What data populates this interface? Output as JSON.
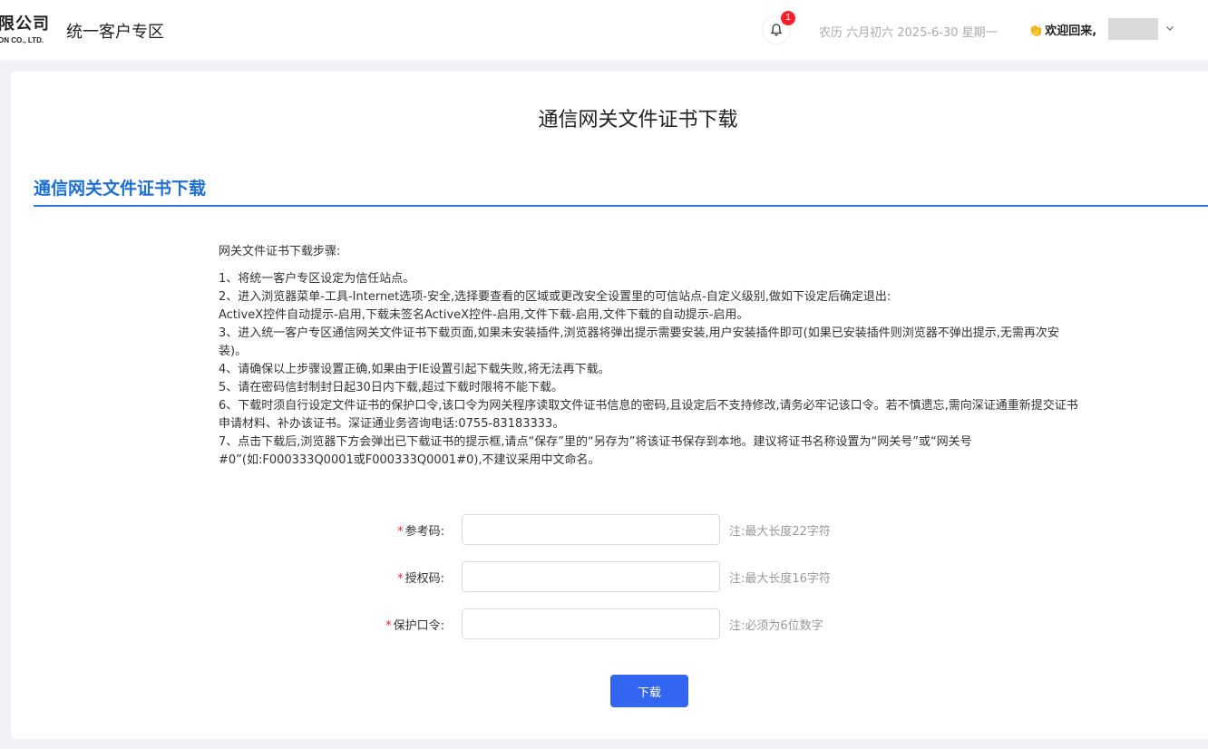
{
  "header": {
    "logo_cn": "限公司",
    "logo_en": "ON CO., LTD.",
    "app_title": "统一客户专区",
    "notification_count": "1",
    "date_text": "农历 六月初六 2025-6-30 星期一",
    "welcome": "欢迎回来,",
    "icons": {
      "bell": "bell-icon",
      "chevron": "chevron-down-icon",
      "clap": "clap-icon"
    }
  },
  "main": {
    "page_title": "通信网关文件证书下载",
    "section_title": "通信网关文件证书下载",
    "steps_heading": "网关文件证书下载步骤:",
    "steps": [
      "1、将统一客户专区设定为信任站点。",
      "2、进入浏览器菜单-工具-Internet选项-安全,选择要查看的区域或更改安全设置里的可信站点-自定义级别,做如下设定后确定退出:",
      "ActiveX控件自动提示-启用,下载未签名ActiveX控件-启用,文件下载-启用,文件下载的自动提示-启用。",
      "3、进入统一客户专区通信网关文件证书下载页面,如果未安装插件,浏览器将弹出提示需要安装,用户安装插件即可(如果已安装插件则浏览器不弹出提示,无需再次安装)。",
      "4、请确保以上步骤设置正确,如果由于IE设置引起下载失败,将无法再下载。",
      "5、请在密码信封制封日起30日内下载,超过下载时限将不能下载。",
      "6、下载时须自行设定文件证书的保护口令,该口令为网关程序读取文件证书信息的密码,且设定后不支持修改,请务必牢记该口令。若不慎遗忘,需向深证通重新提交证书申请材料、补办该证书。深证通业务咨询电话:0755-83183333。",
      "7、点击下载后,浏览器下方会弹出已下载证书的提示框,请点“保存”里的“另存为”将该证书保存到本地。建议将证书名称设置为“网关号”或“网关号#0”(如:F000333Q0001或F000333Q0001#0),不建议采用中文命名。"
    ],
    "form": {
      "required_mark": "*",
      "fields": [
        {
          "label": "参考码:",
          "value": "",
          "note": "注:最大长度22字符"
        },
        {
          "label": "授权码:",
          "value": "",
          "note": "注:最大长度16字符"
        },
        {
          "label": "保护口令:",
          "value": "",
          "note": "注:必须为6位数字"
        }
      ],
      "submit_label": "下载"
    }
  },
  "colors": {
    "accent": "#3266f0",
    "section_title": "#1d6fd6",
    "required": "#f5222d",
    "badge": "#f5222d"
  }
}
